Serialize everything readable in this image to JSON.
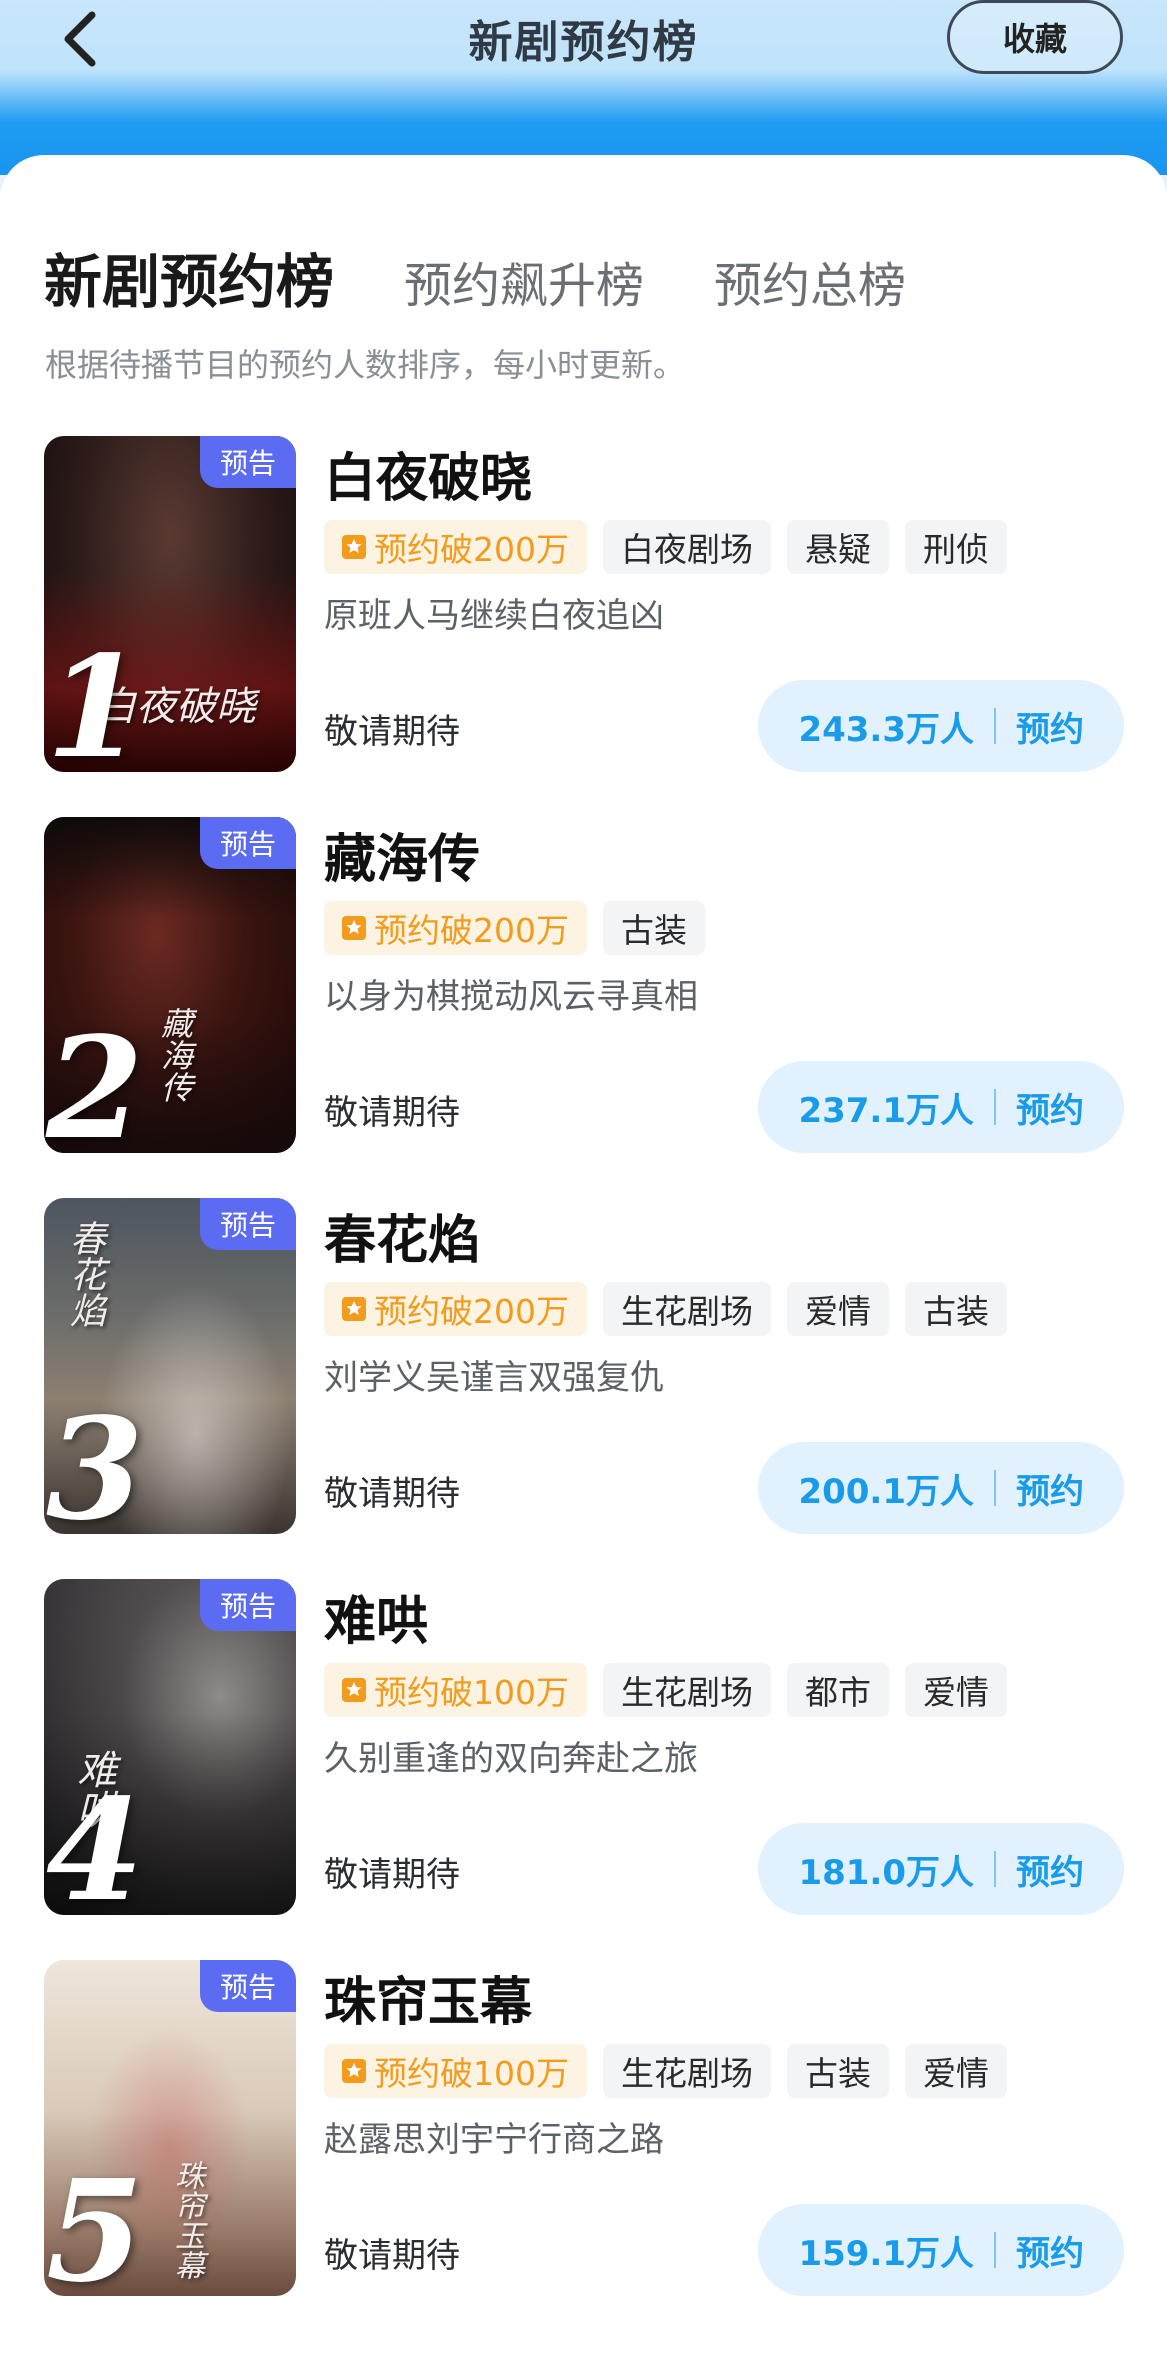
{
  "header": {
    "title": "新剧预约榜",
    "fav_label": "收藏"
  },
  "tabs": [
    {
      "label": "新剧预约榜",
      "active": true
    },
    {
      "label": "预约飙升榜",
      "active": false
    },
    {
      "label": "预约总榜",
      "active": false
    }
  ],
  "description": "根据待播节目的预约人数排序，每小时更新。",
  "items": [
    {
      "rank": "1",
      "badge": "预告",
      "title": "白夜破晓",
      "hot_tag": "预约破200万",
      "tags": [
        "白夜剧场",
        "悬疑",
        "刑侦"
      ],
      "subtitle": "原班人马继续白夜追凶",
      "status": "敬请期待",
      "count": "243.3万人",
      "action": "预约",
      "poster_text": "白夜破晓"
    },
    {
      "rank": "2",
      "badge": "预告",
      "title": "藏海传",
      "hot_tag": "预约破200万",
      "tags": [
        "古装"
      ],
      "subtitle": "以身为棋搅动风云寻真相",
      "status": "敬请期待",
      "count": "237.1万人",
      "action": "预约",
      "poster_text": "藏海传"
    },
    {
      "rank": "3",
      "badge": "预告",
      "title": "春花焰",
      "hot_tag": "预约破200万",
      "tags": [
        "生花剧场",
        "爱情",
        "古装"
      ],
      "subtitle": "刘学义吴谨言双强复仇",
      "status": "敬请期待",
      "count": "200.1万人",
      "action": "预约",
      "poster_text": "春花焰"
    },
    {
      "rank": "4",
      "badge": "预告",
      "title": "难哄",
      "hot_tag": "预约破100万",
      "tags": [
        "生花剧场",
        "都市",
        "爱情"
      ],
      "subtitle": "久别重逢的双向奔赴之旅",
      "status": "敬请期待",
      "count": "181.0万人",
      "action": "预约",
      "poster_text": "难哄"
    },
    {
      "rank": "5",
      "badge": "预告",
      "title": "珠帘玉幕",
      "hot_tag": "预约破100万",
      "tags": [
        "生花剧场",
        "古装",
        "爱情"
      ],
      "subtitle": "赵露思刘宇宁行商之路",
      "status": "敬请期待",
      "count": "159.1万人",
      "action": "预约",
      "poster_text": "珠帘玉幕"
    }
  ],
  "colors": {
    "accent": "#1a9bea",
    "badge": "#5b6cf2",
    "hot": "#f29b1c"
  }
}
